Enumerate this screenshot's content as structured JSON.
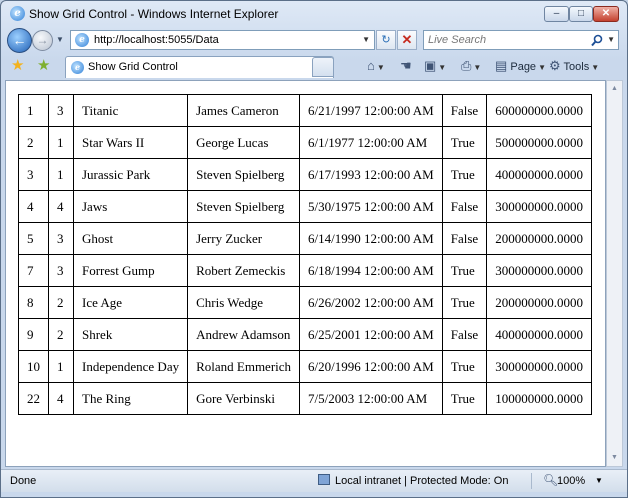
{
  "window": {
    "title": "Show Grid Control - Windows Internet Explorer",
    "minimize_glyph": "–",
    "maximize_glyph": "□",
    "close_glyph": "✕"
  },
  "nav": {
    "back_glyph": "←",
    "forward_glyph": "→",
    "address": "http://localhost:5055/Data",
    "search_placeholder": "Live Search"
  },
  "tab": {
    "label": "Show Grid Control"
  },
  "commands": {
    "page": "Page",
    "tools": "Tools"
  },
  "grid": {
    "rows": [
      [
        "1",
        "3",
        "Titanic",
        "James Cameron",
        "6/21/1997 12:00:00 AM",
        "False",
        "600000000.0000"
      ],
      [
        "2",
        "1",
        "Star Wars II",
        "George Lucas",
        "6/1/1977 12:00:00 AM",
        "True",
        "500000000.0000"
      ],
      [
        "3",
        "1",
        "Jurassic Park",
        "Steven Spielberg",
        "6/17/1993 12:00:00 AM",
        "True",
        "400000000.0000"
      ],
      [
        "4",
        "4",
        "Jaws",
        "Steven Spielberg",
        "5/30/1975 12:00:00 AM",
        "False",
        "300000000.0000"
      ],
      [
        "5",
        "3",
        "Ghost",
        "Jerry Zucker",
        "6/14/1990 12:00:00 AM",
        "False",
        "200000000.0000"
      ],
      [
        "7",
        "3",
        "Forrest Gump",
        "Robert Zemeckis",
        "6/18/1994 12:00:00 AM",
        "True",
        "300000000.0000"
      ],
      [
        "8",
        "2",
        "Ice Age",
        "Chris Wedge",
        "6/26/2002 12:00:00 AM",
        "True",
        "200000000.0000"
      ],
      [
        "9",
        "2",
        "Shrek",
        "Andrew Adamson",
        "6/25/2001 12:00:00 AM",
        "False",
        "400000000.0000"
      ],
      [
        "10",
        "1",
        "Independence Day",
        "Roland Emmerich",
        "6/20/1996 12:00:00 AM",
        "True",
        "300000000.0000"
      ],
      [
        "22",
        "4",
        "The Ring",
        "Gore Verbinski",
        "7/5/2003 12:00:00 AM",
        "True",
        "100000000.0000"
      ]
    ]
  },
  "status": {
    "done": "Done",
    "zone": "Local intranet | Protected Mode: On",
    "zoom": "100%"
  },
  "icons": [
    "ie-logo-icon",
    "back-arrow-icon",
    "forward-arrow-icon",
    "refresh-icon",
    "stop-icon",
    "search-icon",
    "favorites-star-icon",
    "add-favorites-icon",
    "tab-grid-icon",
    "home-icon",
    "feeds-icon",
    "print-icon",
    "page-icon",
    "tools-gear-icon",
    "zone-icon",
    "zoom-icon"
  ]
}
